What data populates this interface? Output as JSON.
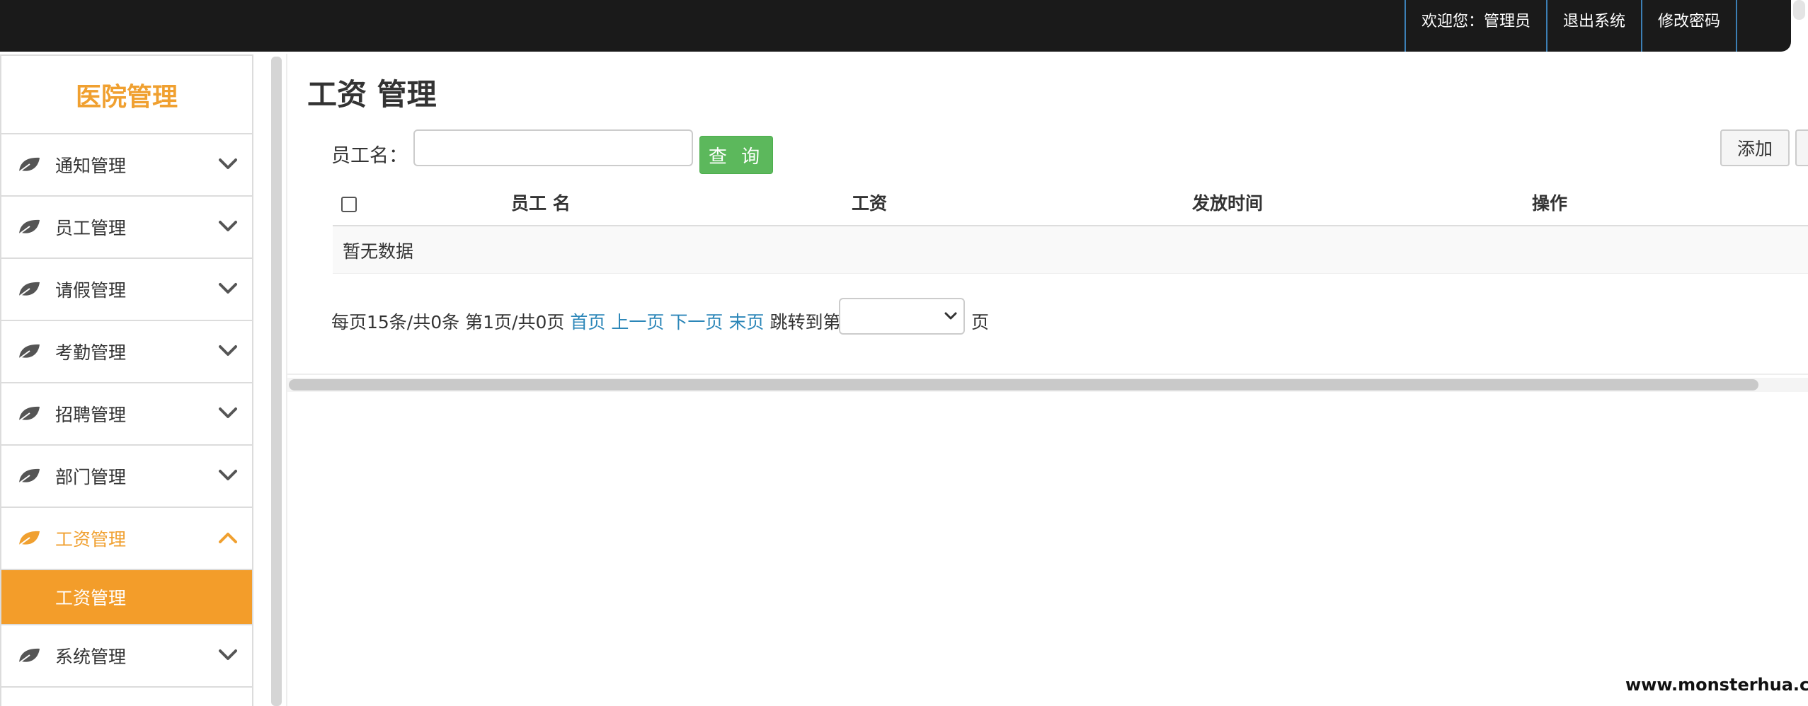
{
  "topbar": {
    "welcome": "欢迎您：管理员",
    "logout": "退出系统",
    "change_password": "修改密码"
  },
  "sidebar": {
    "brand": "医院管理",
    "items": [
      {
        "label": "通知管理",
        "icon": "leaf-icon",
        "expanded": false
      },
      {
        "label": "员工管理",
        "icon": "leaf-icon",
        "expanded": false
      },
      {
        "label": "请假管理",
        "icon": "leaf-icon",
        "expanded": false
      },
      {
        "label": "考勤管理",
        "icon": "leaf-icon",
        "expanded": false
      },
      {
        "label": "招聘管理",
        "icon": "leaf-icon",
        "expanded": false
      },
      {
        "label": "部门管理",
        "icon": "leaf-icon",
        "expanded": false
      },
      {
        "label": "工资管理",
        "icon": "leaf-icon",
        "expanded": true,
        "active": true,
        "children": [
          {
            "label": "工资管理",
            "selected": true
          }
        ]
      },
      {
        "label": "系统管理",
        "icon": "leaf-icon",
        "expanded": false
      }
    ]
  },
  "main": {
    "title": "工资 管理",
    "search": {
      "label": "员工名：",
      "value": "",
      "button": "查 询"
    },
    "add_button": "添加",
    "table": {
      "columns": [
        "员工 名",
        "工资",
        "发放时间",
        "操作"
      ],
      "empty_text": "暂无数据"
    },
    "pagination": {
      "per_page": "每页15条/共0条",
      "page_info": "第1页/共0页",
      "first": "首页",
      "prev": "上一页",
      "next": "下一页",
      "last": "末页",
      "jump_prefix": "跳转到第",
      "jump_value": "",
      "jump_suffix": "页"
    }
  },
  "watermark": "www.monsterhua.com",
  "colors": {
    "accent": "#f39d2a",
    "brand_text": "#f0a030",
    "topbar": "#1a1a1a",
    "query_button": "#5cb85c",
    "link": "#2b86b8"
  }
}
